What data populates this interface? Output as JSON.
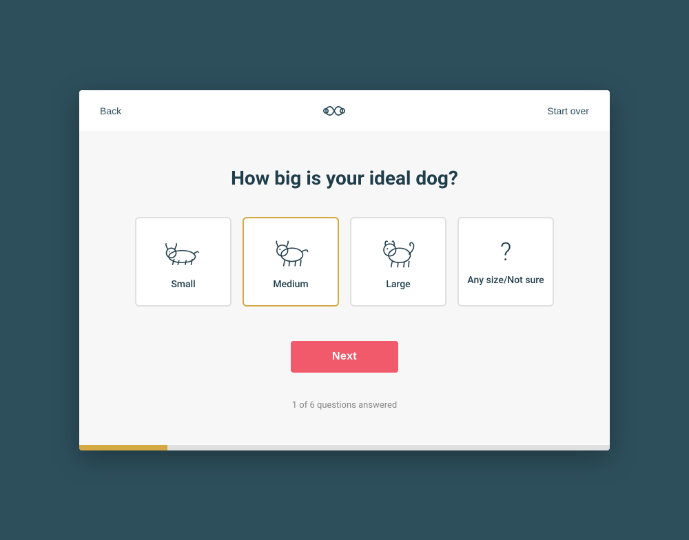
{
  "header": {
    "back_label": "Back",
    "start_over_label": "Start over"
  },
  "question": {
    "title": "How big is your ideal dog?"
  },
  "options": [
    {
      "id": "small",
      "label": "Small",
      "selected": false
    },
    {
      "id": "medium",
      "label": "Medium",
      "selected": true
    },
    {
      "id": "large",
      "label": "Large",
      "selected": false
    },
    {
      "id": "any",
      "label": "Any size/Not sure",
      "selected": false
    }
  ],
  "next_button_label": "Next",
  "progress": {
    "text": "1 of 6 questions answered",
    "current": 1,
    "total": 6,
    "percent": 16.66
  }
}
